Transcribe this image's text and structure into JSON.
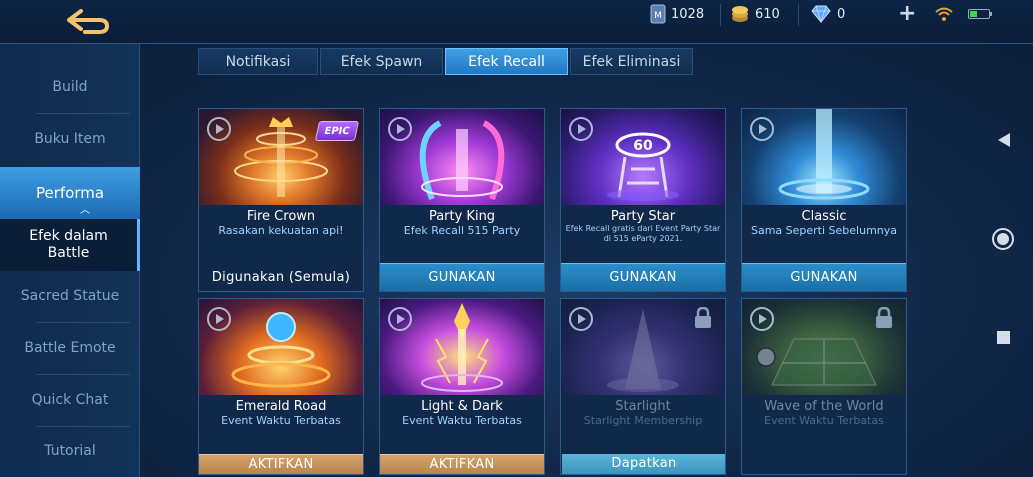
{
  "topbar": {
    "tickets": "1028",
    "coins": "610",
    "diamonds": "0",
    "plus_label": "+"
  },
  "sidebar": {
    "items": [
      {
        "label": "Build"
      },
      {
        "label": "Buku Item"
      },
      {
        "label": "Performa"
      },
      {
        "label": "Efek dalam Battle"
      },
      {
        "label": "Sacred Statue"
      },
      {
        "label": "Battle Emote"
      },
      {
        "label": "Quick Chat"
      },
      {
        "label": "Tutorial"
      }
    ]
  },
  "tabs": [
    {
      "label": "Notifikasi"
    },
    {
      "label": "Efek Spawn"
    },
    {
      "label": "Efek Recall"
    },
    {
      "label": "Efek Eliminasi"
    }
  ],
  "active_tab": "Efek Recall",
  "cards": [
    {
      "name": "Fire Crown",
      "desc": "Rasakan kekuatan api!",
      "button": "Digunakan (Semula)",
      "badge": "EPIC"
    },
    {
      "name": "Party King",
      "desc": "Efek Recall 515 Party",
      "button": "GUNAKAN"
    },
    {
      "name": "Party Star",
      "desc": "Efek Recall gratis dari Event Party Star di 515 eParty 2021.",
      "button": "GUNAKAN"
    },
    {
      "name": "Classic",
      "desc": "Sama Seperti Sebelumnya",
      "button": "GUNAKAN"
    },
    {
      "name": "Emerald Road",
      "desc": "Event Waktu Terbatas",
      "button": "AKTIFKAN"
    },
    {
      "name": "Light & Dark",
      "desc": "Event Waktu Terbatas",
      "button": "AKTIFKAN"
    },
    {
      "name": "Starlight",
      "desc": "Starlight Membership",
      "button": "Dapatkan"
    },
    {
      "name": "Wave of the World",
      "desc": "Event Waktu Terbatas",
      "button": ""
    }
  ],
  "colors": {
    "accent": "#2278c4",
    "use_button": "#1a6ea6",
    "activate_button": "#b8844c",
    "get_button": "#3c94bb"
  }
}
